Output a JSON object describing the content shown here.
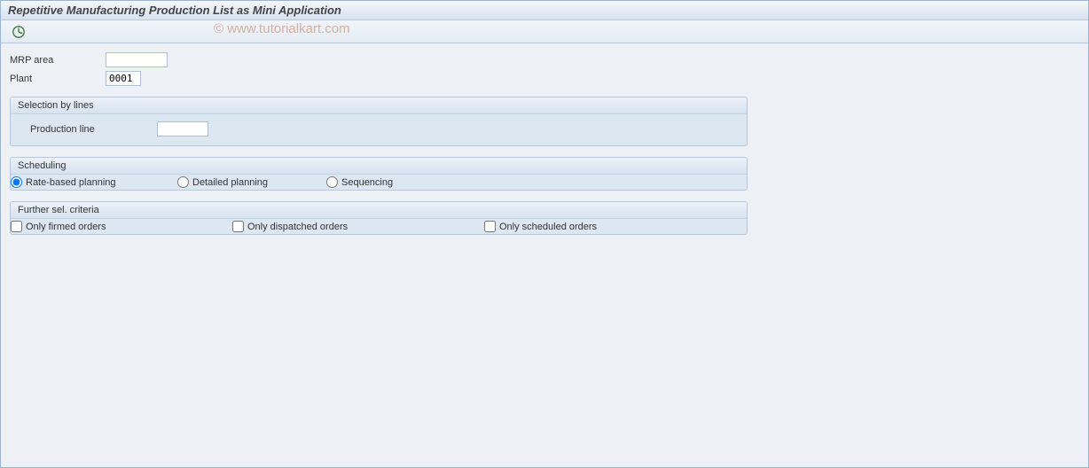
{
  "window": {
    "title": "Repetitive Manufacturing Production List as Mini Application"
  },
  "watermark": "© www.tutorialkart.com",
  "fields": {
    "mrp_area_label": "MRP area",
    "mrp_area_value": "",
    "plant_label": "Plant",
    "plant_value": "0001"
  },
  "groups": {
    "selection_by_lines": {
      "title": "Selection by lines",
      "production_line_label": "Production line",
      "production_line_value": ""
    },
    "scheduling": {
      "title": "Scheduling",
      "options": [
        {
          "label": "Rate-based planning",
          "checked": true
        },
        {
          "label": "Detailed planning",
          "checked": false
        },
        {
          "label": "Sequencing",
          "checked": false
        }
      ]
    },
    "further": {
      "title": "Further sel. criteria",
      "options": [
        {
          "label": "Only firmed orders",
          "checked": false
        },
        {
          "label": "Only dispatched orders",
          "checked": false
        },
        {
          "label": "Only scheduled orders",
          "checked": false
        }
      ]
    }
  }
}
